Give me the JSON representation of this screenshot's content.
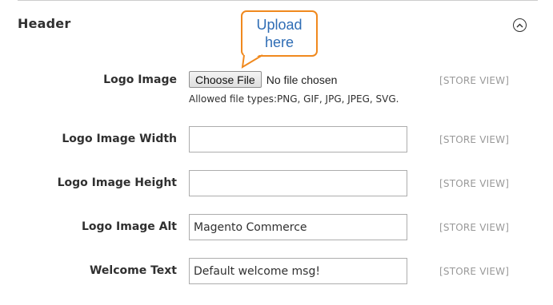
{
  "section": {
    "title": "Header",
    "toggle_icon": "chevron-up-circle-icon"
  },
  "callout": {
    "text": "Upload here",
    "border_color": "#f0891e",
    "text_color": "#2f6db5"
  },
  "fields": {
    "logo_image": {
      "label": "Logo Image",
      "button_label": "Choose File",
      "file_status": "No file chosen",
      "note": "Allowed file types:PNG, GIF, JPG, JPEG, SVG.",
      "scope": "[STORE VIEW]"
    },
    "logo_width": {
      "label": "Logo Image Width",
      "value": "",
      "scope": "[STORE VIEW]"
    },
    "logo_height": {
      "label": "Logo Image Height",
      "value": "",
      "scope": "[STORE VIEW]"
    },
    "logo_alt": {
      "label": "Logo Image Alt",
      "value": "Magento Commerce",
      "scope": "[STORE VIEW]"
    },
    "welcome_text": {
      "label": "Welcome Text",
      "value": "Default welcome msg!",
      "scope": "[STORE VIEW]"
    }
  }
}
